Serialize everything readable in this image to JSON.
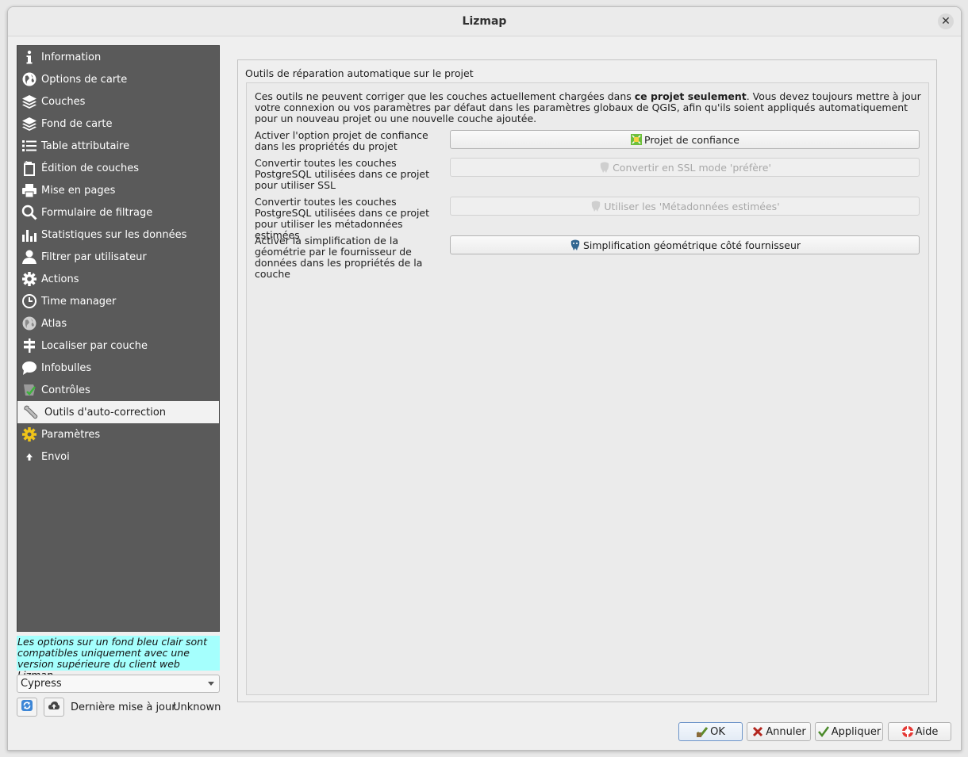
{
  "window": {
    "title": "Lizmap"
  },
  "sidebar": {
    "items": [
      {
        "label": "Information",
        "icon": "info-icon"
      },
      {
        "label": "Options de carte",
        "icon": "globe-icon"
      },
      {
        "label": "Couches",
        "icon": "layers-icon"
      },
      {
        "label": "Fond de carte",
        "icon": "layers-icon"
      },
      {
        "label": "Table attributaire",
        "icon": "list-icon"
      },
      {
        "label": "Édition de couches",
        "icon": "edit-icon"
      },
      {
        "label": "Mise en pages",
        "icon": "printer-icon"
      },
      {
        "label": "Formulaire de filtrage",
        "icon": "search-icon"
      },
      {
        "label": "Statistiques sur les données",
        "icon": "bar-chart-icon"
      },
      {
        "label": "Filtrer par utilisateur",
        "icon": "user-icon"
      },
      {
        "label": "Actions",
        "icon": "gear-icon"
      },
      {
        "label": "Time manager",
        "icon": "clock-icon"
      },
      {
        "label": "Atlas",
        "icon": "globe-icon"
      },
      {
        "label": "Localiser par couche",
        "icon": "signpost-icon"
      },
      {
        "label": "Infobulles",
        "icon": "speech-bubble-icon"
      },
      {
        "label": "Contrôles",
        "icon": "check-icon"
      },
      {
        "label": "Outils d'auto-correction",
        "icon": "wrench-icon"
      },
      {
        "label": "Paramètres",
        "icon": "settings-icon"
      },
      {
        "label": "Envoi",
        "icon": "upload-icon"
      }
    ],
    "active_index": 16
  },
  "notice": "Les options sur un fond bleu clair sont compatibles uniquement avec une version supérieure du client web Lizmap.",
  "server_combo": {
    "value": "Cypress"
  },
  "last_update": {
    "label": "Dernière mise à jour",
    "value": "Unknown"
  },
  "panel": {
    "group_title": "Outils de réparation automatique sur le projet",
    "intro_pre": "Ces outils ne peuvent corriger que les couches actuellement chargées dans ",
    "intro_bold": "ce projet seulement",
    "intro_post": ". Vous devez toujours mettre à jour votre connexion ou vos paramètres par défaut dans les paramètres globaux de QGIS, afin qu'ils soient appliqués automatiquement pour un nouveau projet ou une nouvelle couche ajoutée.",
    "rows": [
      {
        "label": "Activer l'option projet de confiance dans les propriétés du projet",
        "button": "Projet de confiance",
        "enabled": true
      },
      {
        "label": "Convertir toutes les couches PostgreSQL utilisées dans ce projet pour utiliser SSL",
        "button": "Convertir en SSL mode 'préfère'",
        "enabled": false
      },
      {
        "label": "Convertir toutes les couches PostgreSQL utilisées dans ce projet pour utiliser les métadonnées estimées",
        "button": "Utiliser les 'Métadonnées estimées'",
        "enabled": false
      },
      {
        "label": "Activer la simplification de la géométrie par le fournisseur de données dans les propriétés de la couche",
        "button": "Simplification géométrique côté fournisseur",
        "enabled": true
      }
    ]
  },
  "dialog_buttons": {
    "ok": "OK",
    "cancel": "Annuler",
    "apply": "Appliquer",
    "help": "Aide"
  },
  "colors": {
    "sidebar_bg": "#5a5a5a",
    "notice_bg": "#a5fffd",
    "default_button_border": "#6e95c9"
  }
}
